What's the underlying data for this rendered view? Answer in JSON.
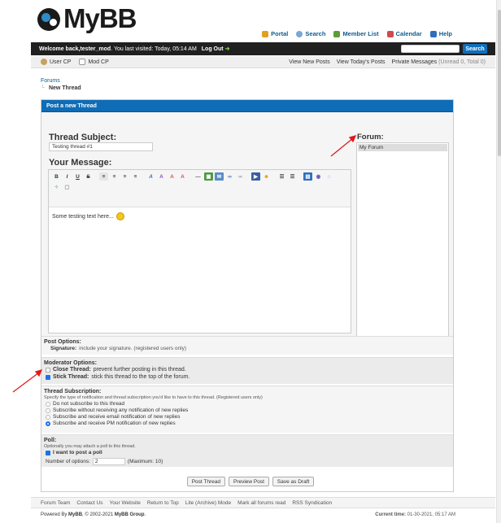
{
  "logo": {
    "text": "MyBB"
  },
  "toplinks": [
    {
      "label": "Portal",
      "icon": "portal-icon",
      "color": "#e0a020"
    },
    {
      "label": "Search",
      "icon": "search-icon",
      "color": "#7aa7d6"
    },
    {
      "label": "Member List",
      "icon": "members-icon",
      "color": "#5a9c3a"
    },
    {
      "label": "Calendar",
      "icon": "calendar-icon",
      "color": "#d24a4a"
    },
    {
      "label": "Help",
      "icon": "help-icon",
      "color": "#2e6fbd"
    }
  ],
  "welcome": {
    "prefix": "Welcome back, ",
    "username": "tester_mod",
    "last_visited": ". You last visited: Today, 05:14 AM",
    "logout": "Log Out",
    "search_btn": "Search"
  },
  "subnav": {
    "user_cp": "User CP",
    "mod_cp": "Mod CP",
    "new_posts": "View New Posts",
    "todays_posts": "View Today's Posts",
    "pm": "Private Messages",
    "pm_counts": "(Unread 0, Total 0)"
  },
  "breadcrumb": {
    "root": "Forums",
    "current": "New Thread"
  },
  "panel_title": "Post a new Thread",
  "thread_subject": {
    "label": "Thread Subject:",
    "value": "Testing thread #1"
  },
  "message": {
    "label": "Your Message:",
    "text": "Some testing text here..."
  },
  "forum": {
    "label": "Forum:",
    "selected": "My Forum"
  },
  "post_options": {
    "title": "Post Options:",
    "signature_bold": "Signature:",
    "signature_desc": "include your signature. (registered users only)"
  },
  "mod_options": {
    "title": "Moderator Options:",
    "close_bold": "Close Thread:",
    "close_desc": "prevent further posting in this thread.",
    "stick_bold": "Stick Thread:",
    "stick_desc": "stick this thread to the top of the forum."
  },
  "subscription": {
    "title": "Thread Subscription:",
    "desc": "Specify the type of notification and thread subscription you'd like to have to this thread. (Registered users only)",
    "options": [
      "Do not subscribe to this thread",
      "Subscribe without receiving any notification of new replies",
      "Subscribe and receive email notification of new replies",
      "Subscribe and receive PM notification of new replies"
    ]
  },
  "poll": {
    "title": "Poll:",
    "desc": "Optionally you may attach a poll to this thread.",
    "want_label": "I want to post a poll",
    "num_label": "Number of options:",
    "num_value": "2",
    "max_label": "(Maximum: 10)"
  },
  "buttons": {
    "post": "Post Thread",
    "preview": "Preview Post",
    "draft": "Save as Draft"
  },
  "footer": {
    "links": [
      "Forum Team",
      "Contact Us",
      "Your Website",
      "Return to Top",
      "Lite (Archive) Mode",
      "Mark all forums read",
      "RSS Syndication"
    ],
    "powered_prefix": "Powered By ",
    "powered_mybb": "MyBB",
    "powered_mid": ", © 2002-2021 ",
    "powered_group": "MyBB Group",
    "powered_end": ".",
    "time_label": "Current time:",
    "time_value": "01-30-2021, 05:17 AM"
  },
  "colors": {
    "accent": "#0f6cb6",
    "header_bar": "#202020",
    "annotation_arrow": "#e01b1b"
  }
}
